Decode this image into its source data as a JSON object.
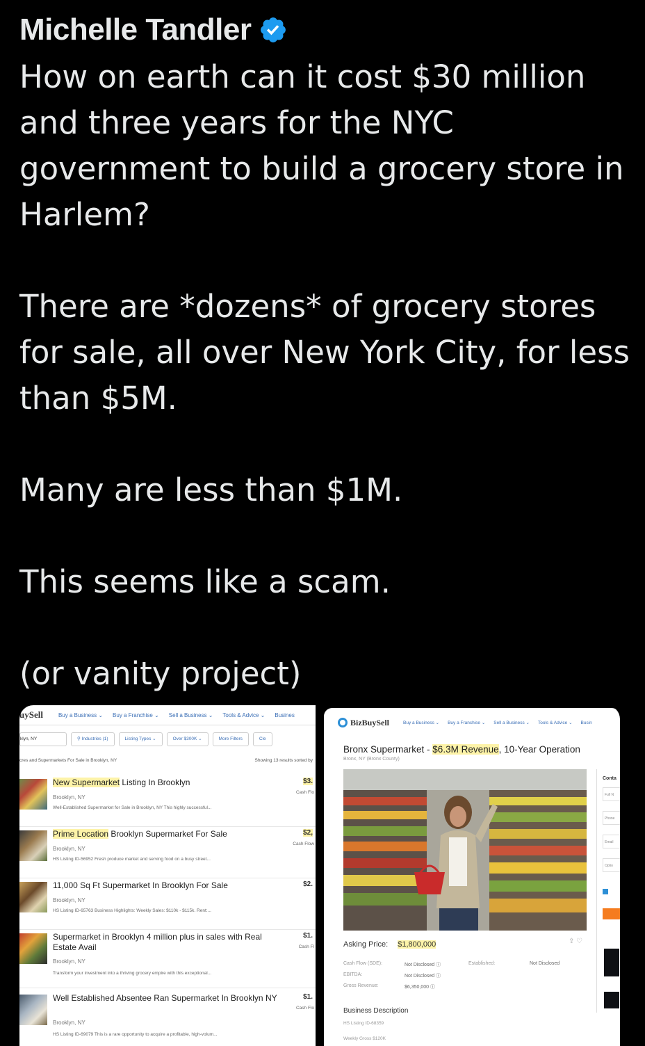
{
  "tweet": {
    "author_name": "Michelle Tandler",
    "paragraphs": [
      "How on earth can it cost $30 million and three years for the NYC government to build a grocery store in Harlem?",
      "There are *dozens* of grocery stores for sale, all over New York City, for less than $5M.",
      "Many are less than $1M.",
      "This seems like a scam.",
      "(or vanity project)"
    ]
  },
  "left_screenshot": {
    "logo": "uySell",
    "nav": [
      "Buy a Business ⌄",
      "Buy a Franchise ⌄",
      "Sell a Business ⌄",
      "Tools & Advice ⌄",
      "Busines"
    ],
    "filters": {
      "location": "klyn, NY",
      "industries": "Industries (1)",
      "listing_types": "Listing Types ⌄",
      "price": "Over $300K ⌄",
      "more": "More Filters",
      "clear": "Cle"
    },
    "results_heading": "cres and Supermarkets For Sale in Brooklyn, NY",
    "results_count": "Showing 13 results sorted by",
    "listings": [
      {
        "title_hl": "New Supermarket",
        "title_rest": " Listing In Brooklyn",
        "location": "Brooklyn, NY",
        "desc": "Well-Established Supermarket for Sale in Brooklyn, NY This highly successful...",
        "price": "$3.",
        "price_sub": "Cash Flo"
      },
      {
        "title_hl": "Prime Location",
        "title_rest": " Brooklyn Supermarket For Sale",
        "location": "Brooklyn, NY",
        "desc": "HS Listing ID-56952 Fresh produce market and serving food on a busy street...",
        "price": "$2,",
        "price_sub": "Cash Flow"
      },
      {
        "title_hl": "",
        "title_rest": "11,000 Sq Ft Supermarket In Brooklyn For Sale",
        "location": "Brooklyn, NY",
        "desc": "HS Listing ID-65763 Business Highlights: Weekly Sales: $110k - $115k. Rent:...",
        "price": "$2.",
        "price_sub": ""
      },
      {
        "title_hl": "",
        "title_rest": "Supermarket in Brooklyn 4 million plus in sales with Real Estate Avail",
        "location": "Brooklyn, NY",
        "desc": "Transform your investment into a thriving grocery empire with this exceptional...",
        "price": "$1.",
        "price_sub": "Cash Fl"
      },
      {
        "title_hl": "",
        "title_rest": "Well Established Absentee Ran Supermarket In Brooklyn NY",
        "location": "Brooklyn, NY",
        "desc": "HS Listing ID-69079 This is a rare opportunity to acquire a profitable, high-volum...",
        "price": "$1.",
        "price_sub": "Cash Flo"
      }
    ]
  },
  "right_screenshot": {
    "logo": "BizBuySell",
    "nav": [
      "Buy a Business ⌄",
      "Buy a Franchise ⌄",
      "Sell a Business ⌄",
      "Tools & Advice ⌄",
      "Busin"
    ],
    "title_start": "Bronx Supermarket - ",
    "title_hl": "$6.3M Revenue",
    "title_end": ", 10-Year Operation",
    "subtitle": "Bronx, NY (Bronx County)",
    "contact_label": "Conta",
    "contact_fields": [
      "Full N",
      "Phone",
      "Email",
      "Optio"
    ],
    "asking_label": "Asking Price:",
    "asking_value": "$1,800,000",
    "financials": [
      {
        "label": "Cash Flow (SDE):",
        "value": "Not Disclosed ⓘ"
      },
      {
        "label": "EBITDA:",
        "value": "Not Disclosed ⓘ"
      },
      {
        "label": "Gross Revenue:",
        "value": "$6,350,000 ⓘ"
      }
    ],
    "established_label": "Established:",
    "established_value": "Not Disclosed",
    "description_heading": "Business Description",
    "description_lines": [
      "HS Listing ID-68359",
      "Weekly Gross $120K"
    ]
  }
}
